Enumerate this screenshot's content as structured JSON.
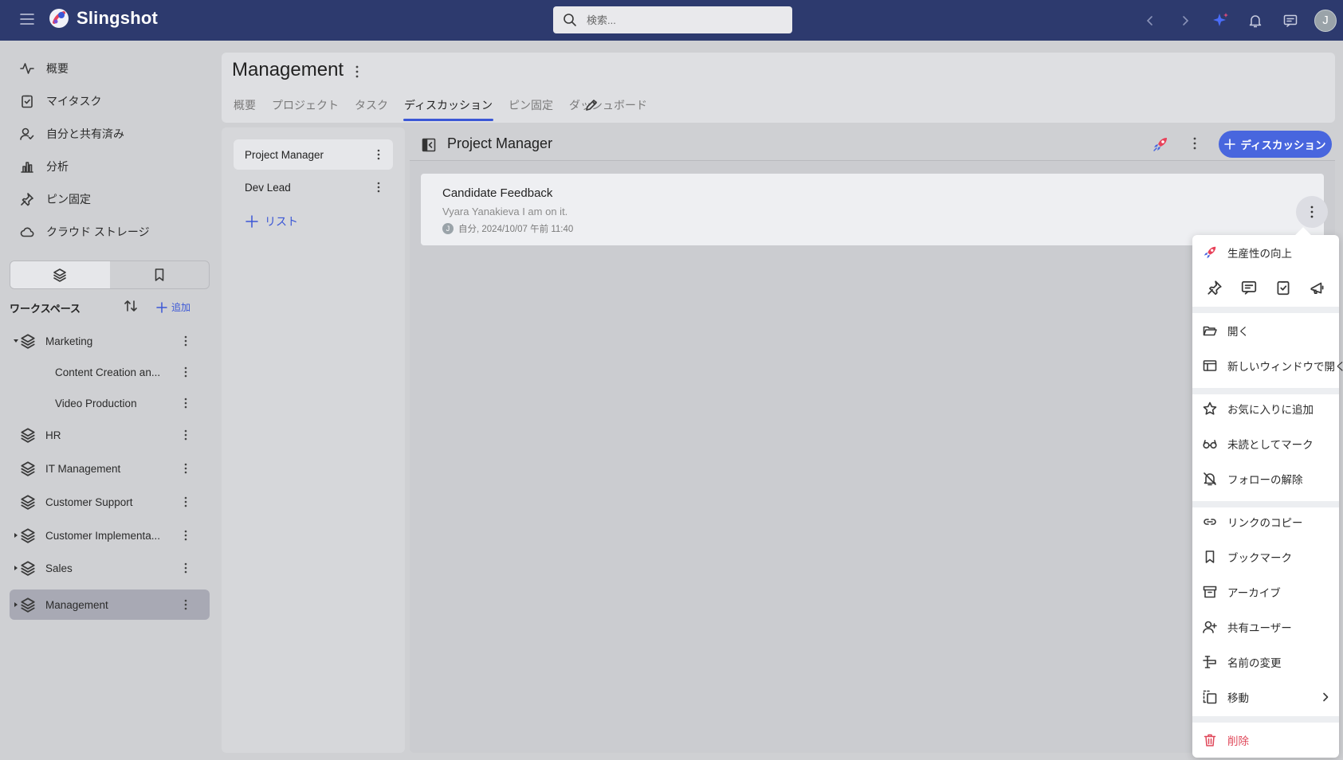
{
  "topbar": {
    "app_name": "Slingshot",
    "search_placeholder": "検索...",
    "user_initial": "J"
  },
  "sidebar": {
    "nav": [
      {
        "label": "概要",
        "icon": "activity-icon"
      },
      {
        "label": "マイタスク",
        "icon": "clipboard-check-icon"
      },
      {
        "label": "自分と共有済み",
        "icon": "user-check-icon"
      },
      {
        "label": "分析",
        "icon": "bar-chart-icon"
      },
      {
        "label": "ピン固定",
        "icon": "pin-icon"
      },
      {
        "label": "クラウド ストレージ",
        "icon": "cloud-icon"
      }
    ],
    "workspaces_label": "ワークスペース",
    "add_label": "追加",
    "workspaces": [
      {
        "label": "Marketing",
        "expanded": true
      },
      {
        "label": "Content Creation an...",
        "child": true
      },
      {
        "label": "Video Production",
        "child": true
      },
      {
        "label": "HR"
      },
      {
        "label": "IT Management"
      },
      {
        "label": "Customer Support"
      },
      {
        "label": "Customer Implementa..."
      },
      {
        "label": "Sales"
      },
      {
        "label": "Management",
        "selected": true
      }
    ]
  },
  "main": {
    "title": "Management",
    "tabs": [
      "概要",
      "プロジェクト",
      "タスク",
      "ディスカッション",
      "ピン固定",
      "ダッシュボード"
    ],
    "active_tab": "ディスカッション"
  },
  "lists": {
    "items": [
      "Project Manager",
      "Dev Lead"
    ],
    "add_label": "リスト"
  },
  "discussion": {
    "title": "Project Manager",
    "new_button": "ディスカッション",
    "card": {
      "title": "Candidate Feedback",
      "subtitle": "Vyara Yanakieva I am on it.",
      "meta": "自分, 2024/10/07 午前 11:40",
      "avatar": "J"
    }
  },
  "context_menu": {
    "productivity": "生産性の向上",
    "open": "開く",
    "open_new_window": "新しいウィンドウで開く",
    "add_favorite": "お気に入りに追加",
    "mark_unread": "未読としてマーク",
    "unfollow": "フォローの解除",
    "copy_link": "リンクのコピー",
    "bookmark": "ブックマーク",
    "archive": "アーカイブ",
    "share_users": "共有ユーザー",
    "rename": "名前の変更",
    "move": "移動",
    "delete": "削除"
  },
  "colors": {
    "topbar": "#2d3a6e",
    "accent": "#4866de",
    "danger": "#e0485a"
  }
}
